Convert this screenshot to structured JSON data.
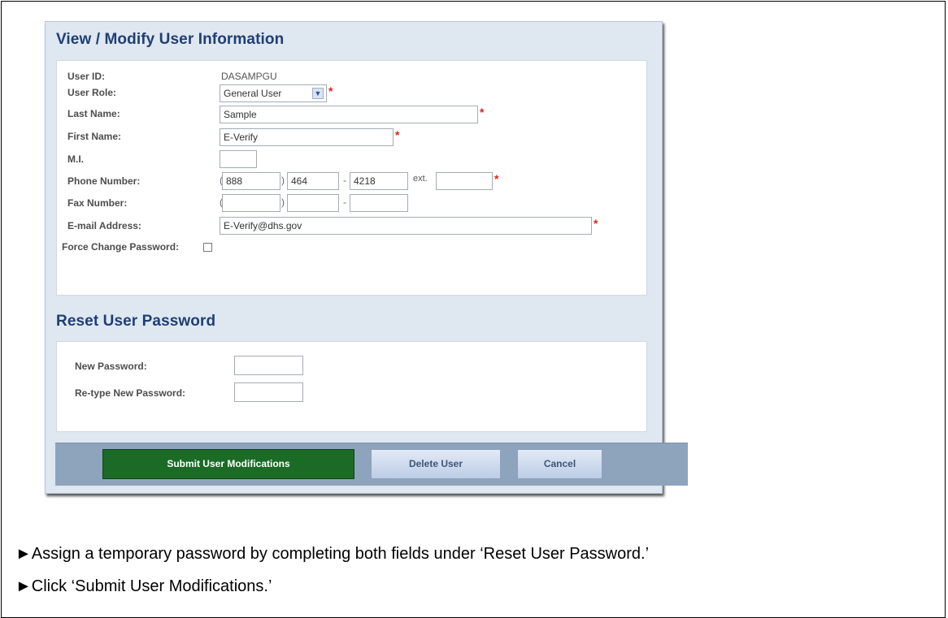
{
  "modify_section": {
    "title": "View / Modify User Information",
    "fields": {
      "user_id_label": "User ID:",
      "user_id_value": "DASAMPGU",
      "user_role_label": "User Role:",
      "user_role_value": "General User",
      "last_name_label": "Last Name:",
      "last_name_value": "Sample",
      "first_name_label": "First Name:",
      "first_name_value": "E-Verify",
      "mi_label": "M.I.",
      "mi_value": "",
      "phone_label": "Phone Number:",
      "phone_area": "888",
      "phone_prefix": "464",
      "phone_line": "4218",
      "phone_ext_label": "ext.",
      "phone_ext": "",
      "fax_label": "Fax Number:",
      "fax_area": "",
      "fax_prefix": "",
      "fax_line": "",
      "email_label": "E-mail Address:",
      "email_value": "E-Verify@dhs.gov",
      "force_change_label": "Force Change Password:"
    },
    "paren_open": "(",
    "paren_close": ")",
    "dash": "-",
    "required_mark": "*"
  },
  "reset_section": {
    "title": "Reset User Password",
    "new_password_label": "New Password:",
    "new_password_value": "",
    "retype_password_label": "Re-type New Password:",
    "retype_password_value": ""
  },
  "buttons": {
    "submit": "Submit User Modifications",
    "delete": "Delete User",
    "cancel": "Cancel"
  },
  "instructions": [
    "►Assign a temporary password by completing both fields under ‘Reset User Password.’",
    "►Click ‘Submit User Modifications.’"
  ],
  "colors": {
    "title": "#1f3f74",
    "panel": "#dfe7f1",
    "submit_button": "#1b6b27",
    "required": "#e02020"
  }
}
